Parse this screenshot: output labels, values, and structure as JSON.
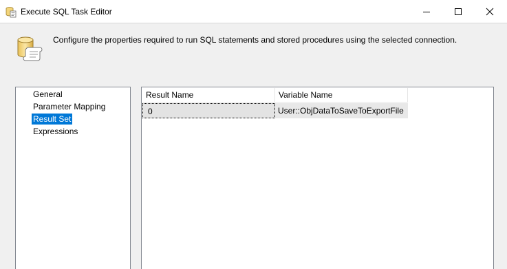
{
  "window": {
    "title": "Execute SQL Task Editor",
    "controls": [
      "minimize-icon",
      "maximize-icon",
      "close-icon"
    ]
  },
  "header": {
    "description": "Configure the properties required to run SQL statements and stored procedures using the selected connection.",
    "icon": "sql-task-scroll-icon"
  },
  "nav": {
    "items": [
      {
        "label": "General",
        "selected": false
      },
      {
        "label": "Parameter Mapping",
        "selected": false
      },
      {
        "label": "Result Set",
        "selected": true
      },
      {
        "label": "Expressions",
        "selected": false
      }
    ]
  },
  "result_grid": {
    "columns": [
      "Result Name",
      "Variable Name"
    ],
    "rows": [
      {
        "result_name": "0",
        "variable_name": "User::ObjDataToSaveToExportFile"
      }
    ]
  },
  "colors": {
    "selection": "#0078d7",
    "titlebar": "#ffffff",
    "window_bg": "#f0f0f0"
  }
}
